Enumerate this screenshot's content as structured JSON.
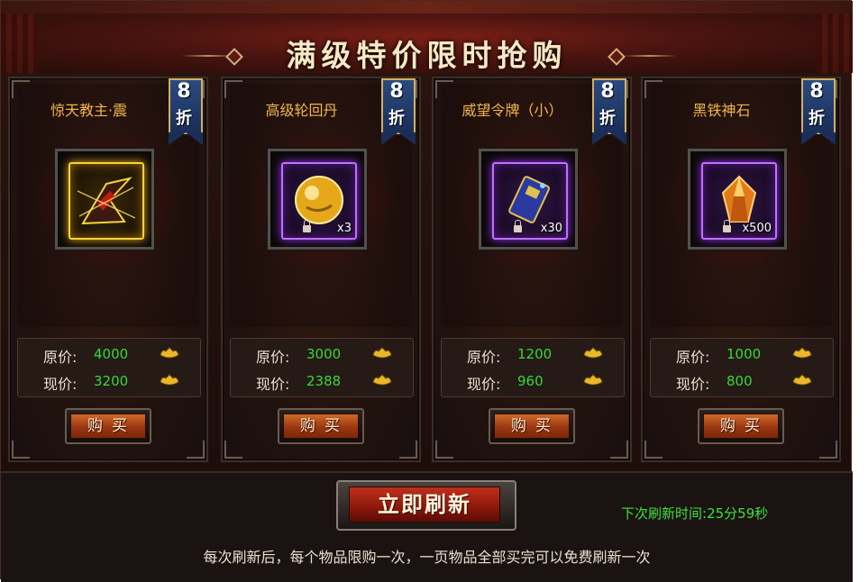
{
  "title": "满级特价限时抢购",
  "cards": [
    {
      "name": "惊天教主·震",
      "discount_num": "8",
      "discount_suffix": "折",
      "quantity": "",
      "original_label": "原价:",
      "original_price": "4000",
      "current_label": "现价:",
      "current_price": "3200",
      "buy_label": "购买",
      "icon": "dark-shard-icon",
      "rarity_color": "#f2d43a"
    },
    {
      "name": "高级轮回丹",
      "discount_num": "8",
      "discount_suffix": "折",
      "quantity": "x3",
      "original_label": "原价:",
      "original_price": "3000",
      "current_label": "现价:",
      "current_price": "2388",
      "buy_label": "购买",
      "icon": "golden-orb-icon",
      "rarity_color": "#c070ff"
    },
    {
      "name": "威望令牌（小）",
      "discount_num": "8",
      "discount_suffix": "折",
      "quantity": "x30",
      "original_label": "原价:",
      "original_price": "1200",
      "current_label": "现价:",
      "current_price": "960",
      "buy_label": "购买",
      "icon": "prestige-token-icon",
      "rarity_color": "#c070ff"
    },
    {
      "name": "黑铁神石",
      "discount_num": "8",
      "discount_suffix": "折",
      "quantity": "x500",
      "original_label": "原价:",
      "original_price": "1000",
      "current_label": "现价:",
      "current_price": "800",
      "buy_label": "购买",
      "icon": "iron-stone-icon",
      "rarity_color": "#c070ff"
    }
  ],
  "refresh_label": "立即刷新",
  "timer_label": "下次刷新时间:",
  "timer_value": "25分59秒",
  "note": "每次刷新后，每个物品限购一次，一页物品全部买完可以免费刷新一次",
  "colors": {
    "price_green": "#38d83a",
    "name_gold": "#f2b64a",
    "timer_green": "#3ee040"
  }
}
